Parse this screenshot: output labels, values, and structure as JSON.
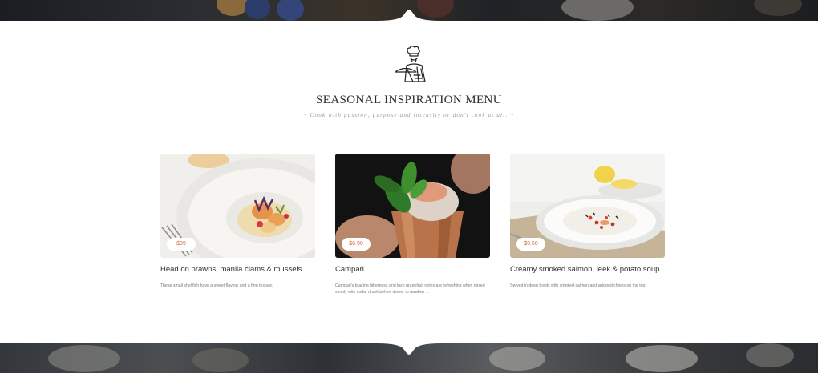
{
  "header": {
    "title": "SEASONAL INSPIRATION MENU",
    "subtitle": "~ Cook with passion, purpose and intensity or don't cook at all. ~"
  },
  "menu": {
    "items": [
      {
        "price": "$39",
        "title": "Head on prawns, manila clams & mussels",
        "description": "These small shellfish have a sweet flavour and a firm texture.",
        "image": "plated-prawns-photo"
      },
      {
        "price": "$6.90",
        "title": "Campari",
        "description": "Campari's bracing bitterness and lush grapefruit notes are refreshing when mixed simply with soda, drunk before dinner to awaken ...",
        "image": "copper-mug-cocktail-photo"
      },
      {
        "price": "$9.50",
        "title": "Creamy smoked salmon, leek & potato soup",
        "description": "Served in deep bowls with smoked salmon and snipped chives on the top.",
        "image": "soup-bowl-photo"
      }
    ]
  },
  "colors": {
    "accent": "#d2693c",
    "title": "#2c2c2c",
    "text": "#333333",
    "muted": "#7a7a7a"
  },
  "icons": {
    "logo": "chef-serving-icon"
  }
}
